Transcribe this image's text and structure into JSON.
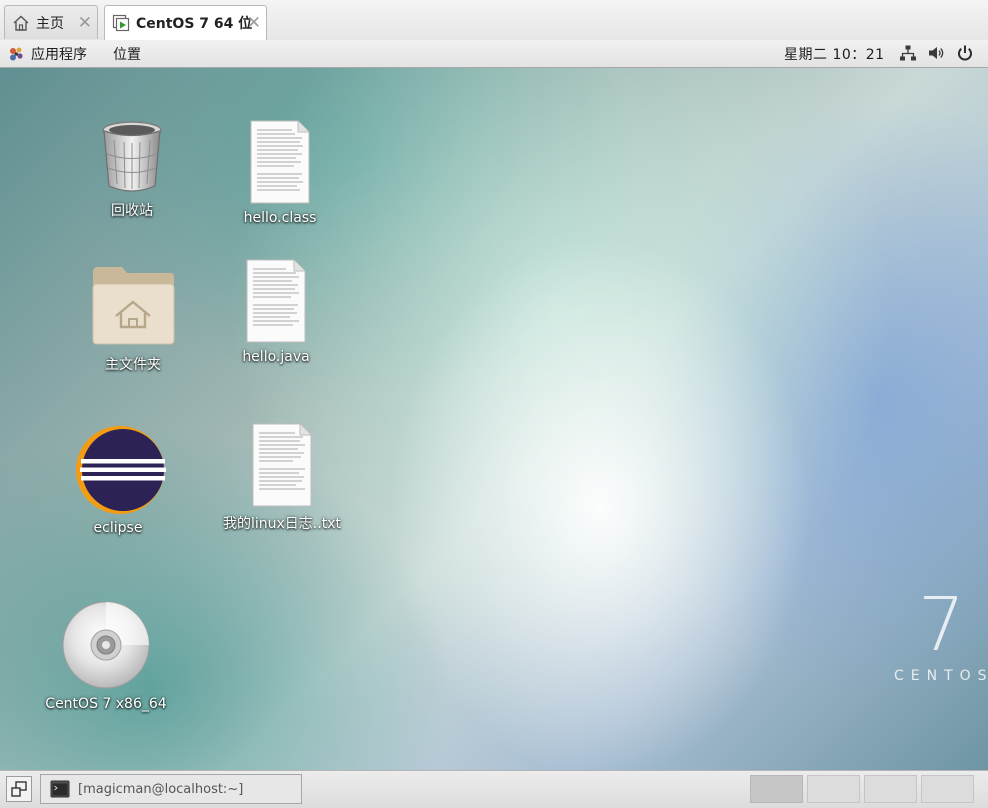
{
  "tabs": [
    {
      "label": "主页",
      "icon": "home-icon"
    },
    {
      "label": "CentOS 7 64 位",
      "icon": "vm-icon"
    }
  ],
  "panel": {
    "applications": "应用程序",
    "places": "位置",
    "clock": "星期二 10：21",
    "tray": [
      "network-icon",
      "volume-icon",
      "power-icon"
    ]
  },
  "desktop": {
    "icons": [
      {
        "label": "回收站",
        "icon": "trash-icon"
      },
      {
        "label": "hello.class",
        "icon": "document-icon"
      },
      {
        "label": "主文件夹",
        "icon": "home-folder-icon"
      },
      {
        "label": "hello.java",
        "icon": "document-icon"
      },
      {
        "label": "eclipse",
        "icon": "eclipse-icon"
      },
      {
        "label": "我的linux日志..txt",
        "icon": "document-icon"
      },
      {
        "label": "CentOS 7 x86_64",
        "icon": "disc-icon"
      }
    ],
    "brand_number": "7",
    "brand_text": "CENTOS"
  },
  "taskbar": {
    "window_title": "[magicman@localhost:~]",
    "workspaces": 4,
    "active_workspace": 1
  }
}
